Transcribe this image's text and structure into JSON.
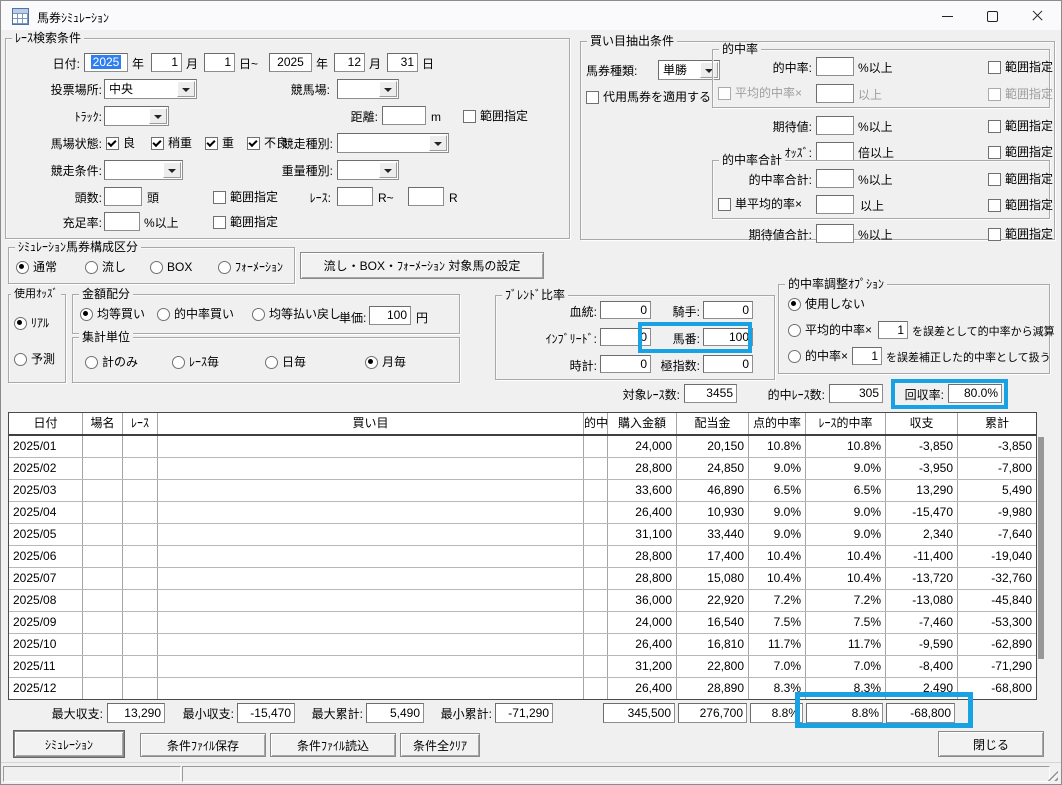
{
  "window": {
    "title": "馬券ｼﾐｭﾚｰｼｮﾝ"
  },
  "search": {
    "caption": "ﾚｰｽ検索条件",
    "date_label": "日付:",
    "year1": "2025",
    "suf_year": "年",
    "month1": "1",
    "suf_month": "月",
    "day1": "1",
    "suf_day_tilde": "日~",
    "year2": "2025",
    "month2": "12",
    "day2": "31",
    "suf_day": "日",
    "place_label": "投票場所:",
    "place_value": "中央",
    "course_label": "競馬場:",
    "course_value": "",
    "track_label": "ﾄﾗｯｸ:",
    "track_value": "",
    "dist_label": "距離:",
    "dist_value": "",
    "dist_unit": "m",
    "range_label": "範囲指定",
    "baba_label": "馬場状態:",
    "baba1": "良",
    "baba2": "稍重",
    "baba3": "重",
    "baba4": "不良",
    "racetype_label": "競走種別:",
    "racetype_value": "",
    "racecond_label": "競走条件:",
    "racecond_value": "",
    "weight_label": "重量種別:",
    "weight_value": "",
    "heads_label": "頭数:",
    "heads_value": "",
    "heads_unit": "頭",
    "race_label": "ﾚｰｽ:",
    "race_from": "",
    "race_sep": "R~",
    "race_to": "",
    "race_unit": "R",
    "fill_label": "充足率:",
    "fill_value": "",
    "fill_unit": "%以上"
  },
  "extract": {
    "caption": "買い目抽出条件",
    "ticket_label": "馬券種類:",
    "ticket_value": "単勝",
    "alt_label": "代用馬券を適用する",
    "hit_caption": "的中率",
    "hit_label": "的中率:",
    "hit_value": "",
    "pct_unit": "%以上",
    "range_label": "範囲指定",
    "avg_label": "平均的中率×",
    "avg_value": "",
    "ge_unit": "以上",
    "expect_label": "期待値:",
    "expect_value": "",
    "odds_label": "ｵｯｽﾞ:",
    "odds_value": "",
    "odds_unit": "倍以上",
    "total_caption": "的中率合計",
    "total_label": "的中率合計:",
    "total_value": "",
    "single_label": "単平均的率×",
    "single_value": "",
    "expect_total_label": "期待値合計:",
    "expect_total_value": ""
  },
  "simkind": {
    "caption": "ｼﾐｭﾚｰｼｮﾝ馬券構成区分",
    "opt1": "通常",
    "opt2": "流し",
    "opt3": "BOX",
    "opt4": "ﾌｫｰﾒｰｼｮﾝ",
    "selected": "通常",
    "setup_button": "流し・BOX・ﾌｫｰﾒｰｼｮﾝ 対象馬の設定"
  },
  "oddssrc": {
    "caption": "使用ｵｯｽﾞ",
    "opt1": "ﾘｱﾙ",
    "opt2": "予測",
    "selected": "ﾘｱﾙ"
  },
  "amount": {
    "caption": "金額配分",
    "opt1": "均等買い",
    "opt2": "的中率買い",
    "opt3": "均等払い戻し",
    "selected": "均等買い",
    "unit_label": "単価:",
    "unit_value": "100",
    "unit_suffix": "円"
  },
  "agg": {
    "caption": "集計単位",
    "opt1": "計のみ",
    "opt2": "ﾚｰｽ毎",
    "opt3": "日毎",
    "opt4": "月毎",
    "selected": "月毎"
  },
  "blend": {
    "caption": "ﾌﾞﾚﾝﾄﾞ比率",
    "blood_label": "血統:",
    "blood": "0",
    "jockey_label": "騎手:",
    "jockey": "0",
    "inbreed_label": "ｲﾝﾌﾞﾘｰﾄﾞ:",
    "inbreed": "0",
    "umaban_label": "馬番:",
    "umaban": "100",
    "clock_label": "時計:",
    "clock": "0",
    "kiwami_label": "極指数:",
    "kiwami": "0"
  },
  "adjust": {
    "caption": "的中率調整ｵﾌﾟｼｮﾝ",
    "opt1": "使用しない",
    "opt2_label": "平均的中率×",
    "opt2_value": "1",
    "opt2_suffix": "を誤差として的中率から減算",
    "opt3_label": "的中率×",
    "opt3_value": "1",
    "opt3_suffix": "を誤差補正した的中率として扱う",
    "selected": "使用しない"
  },
  "stats": {
    "target_label": "対象ﾚｰｽ数:",
    "target_value": "3455",
    "hit_label": "的中ﾚｰｽ数:",
    "hit_value": "305",
    "recovery_label": "回収率:",
    "recovery_value": "80.0%"
  },
  "table": {
    "headers": [
      "日付",
      "場名",
      "ﾚｰｽ",
      "買い目",
      "的中",
      "購入金額",
      "配当金",
      "点的中率",
      "ﾚｰｽ的中率",
      "収支",
      "累計"
    ],
    "rows": [
      [
        "2025/01",
        "",
        "",
        "",
        "",
        "24,000",
        "20,150",
        "10.8%",
        "10.8%",
        "-3,850",
        "-3,850"
      ],
      [
        "2025/02",
        "",
        "",
        "",
        "",
        "28,800",
        "24,850",
        "9.0%",
        "9.0%",
        "-3,950",
        "-7,800"
      ],
      [
        "2025/03",
        "",
        "",
        "",
        "",
        "33,600",
        "46,890",
        "6.5%",
        "6.5%",
        "13,290",
        "5,490"
      ],
      [
        "2025/04",
        "",
        "",
        "",
        "",
        "26,400",
        "10,930",
        "9.0%",
        "9.0%",
        "-15,470",
        "-9,980"
      ],
      [
        "2025/05",
        "",
        "",
        "",
        "",
        "31,100",
        "33,440",
        "9.0%",
        "9.0%",
        "2,340",
        "-7,640"
      ],
      [
        "2025/06",
        "",
        "",
        "",
        "",
        "28,800",
        "17,400",
        "10.4%",
        "10.4%",
        "-11,400",
        "-19,040"
      ],
      [
        "2025/07",
        "",
        "",
        "",
        "",
        "28,800",
        "15,080",
        "10.4%",
        "10.4%",
        "-13,720",
        "-32,760"
      ],
      [
        "2025/08",
        "",
        "",
        "",
        "",
        "36,000",
        "22,920",
        "7.2%",
        "7.2%",
        "-13,080",
        "-45,840"
      ],
      [
        "2025/09",
        "",
        "",
        "",
        "",
        "24,000",
        "16,540",
        "7.5%",
        "7.5%",
        "-7,460",
        "-53,300"
      ],
      [
        "2025/10",
        "",
        "",
        "",
        "",
        "26,400",
        "16,810",
        "11.7%",
        "11.7%",
        "-9,590",
        "-62,890"
      ],
      [
        "2025/11",
        "",
        "",
        "",
        "",
        "31,200",
        "22,800",
        "7.0%",
        "7.0%",
        "-8,400",
        "-71,290"
      ],
      [
        "2025/12",
        "",
        "",
        "",
        "",
        "26,400",
        "28,890",
        "8.3%",
        "8.3%",
        "2,490",
        "-68,800"
      ]
    ],
    "totals": {
      "purchase": "345,500",
      "payout": "276,700",
      "point_rate": "8.8%",
      "race_rate": "8.8%",
      "balance": "-68,800"
    }
  },
  "summary": {
    "max_balance_label": "最大収支:",
    "max_balance": "13,290",
    "min_balance_label": "最小収支:",
    "min_balance": "-15,470",
    "max_total_label": "最大累計:",
    "max_total": "5,490",
    "min_total_label": "最小累計:",
    "min_total": "-71,290"
  },
  "actions": {
    "simulate": "ｼﾐｭﾚｰｼｮﾝ",
    "save": "条件ﾌｧｲﾙ保存",
    "load": "条件ﾌｧｲﾙ読込",
    "clear": "条件全ｸﾘｱ",
    "close": "閉じる"
  },
  "colors": {
    "accent": "#18a2e3",
    "selection": "#2f7ef0"
  }
}
